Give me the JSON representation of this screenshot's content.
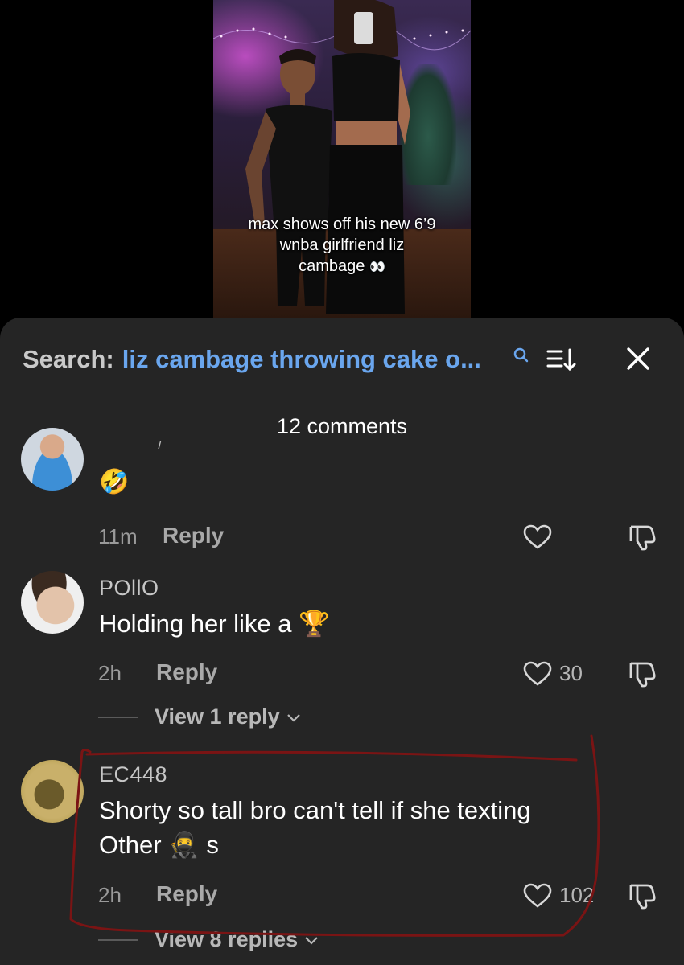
{
  "video": {
    "caption_line1": "max shows off his new 6’9",
    "caption_line2": "wnba girlfriend liz",
    "caption_line3": "cambage",
    "caption_emoji": "👀"
  },
  "search": {
    "prefix": "Search:",
    "query": "liz cambage throwing cake o..."
  },
  "comments_header": {
    "count_label": "12 comments"
  },
  "comments": [
    {
      "username": "",
      "text_partial": "' ' ' /",
      "emoji": "🤣",
      "time": "11m",
      "reply_label": "Reply",
      "like_count": ""
    },
    {
      "username": "POllO",
      "text": "Holding her like a",
      "emoji": "🏆",
      "time": "2h",
      "reply_label": "Reply",
      "like_count": "30",
      "view_replies": "View 1 reply"
    },
    {
      "username": "EC448",
      "text_line1": "Shorty so tall bro can't tell if she texting",
      "text_line2_a": "Other",
      "emoji": "🥷",
      "text_line2_b": "s",
      "time": "2h",
      "reply_label": "Reply",
      "like_count": "102",
      "view_replies": "View 8 replies"
    }
  ],
  "colors": {
    "panel_bg": "#252525",
    "search_query": "#6aa6ee",
    "annotation_stroke": "#7a1414"
  },
  "icons": [
    "search-icon",
    "sort-icon",
    "close-icon",
    "heart-icon",
    "dislike-icon",
    "chevron-down-icon"
  ]
}
